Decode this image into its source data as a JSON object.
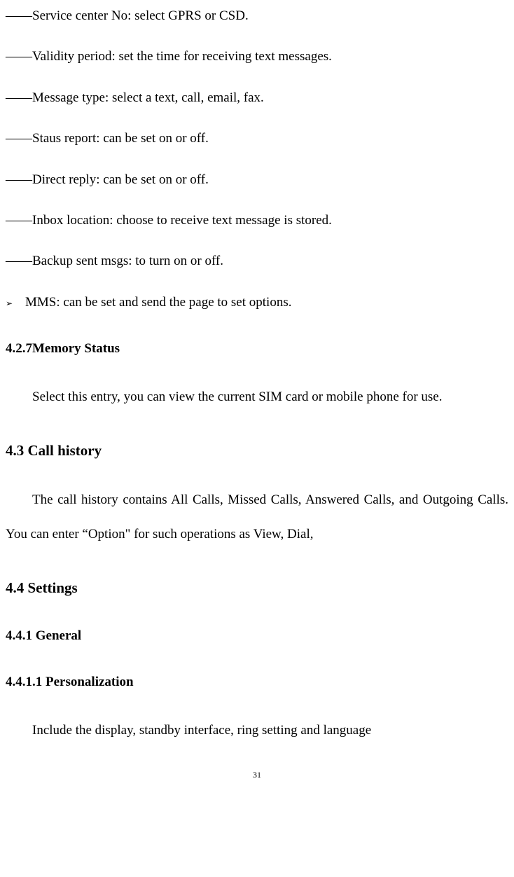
{
  "items": {
    "service_center": "——Service center No: select GPRS or CSD.",
    "validity": "——Validity period: set the time for receiving text messages.",
    "message_type": "——Message type: select a text, call, email, fax.",
    "status_report": "——Staus report: can be set on or off.",
    "direct_reply": "——Direct reply: can be set on or off.",
    "inbox_location": "——Inbox location: choose to receive text message is stored.",
    "backup_sent": "——Backup sent msgs: to turn on or off.",
    "mms": "MMS: can be set and send the page to set options."
  },
  "headings": {
    "memory_status": "4.2.7Memory Status",
    "call_history": "4.3 Call history",
    "settings": "4.4 Settings",
    "general": "4.4.1 General",
    "personalization": "4.4.1.1 Personalization"
  },
  "paragraphs": {
    "memory_status_body": "Select this entry, you can view the current SIM card or mobile phone for use.",
    "call_history_body": "The call history contains All Calls, Missed Calls, Answered Calls, and Outgoing Calls. You can enter “Option\" for such operations as View, Dial,",
    "personalization_body": "Include the display, standby interface, ring setting and language"
  },
  "page_number": "31"
}
